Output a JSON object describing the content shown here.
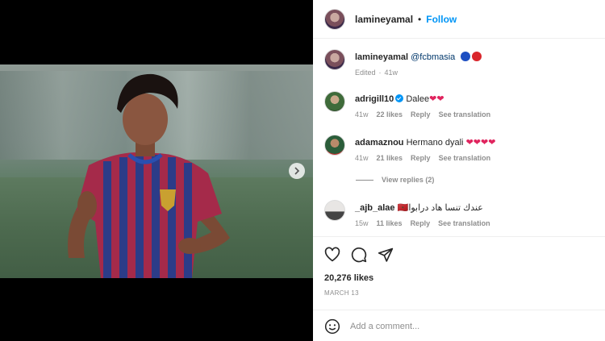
{
  "header": {
    "username": "lamineyamal",
    "separator": "•",
    "follow_label": "Follow"
  },
  "caption": {
    "username": "lamineyamal",
    "mention": "@fcbmasia",
    "status": "Edited",
    "time": "41w"
  },
  "comments": [
    {
      "username": "adrigill10",
      "text": "Dalee",
      "hearts": "❤❤",
      "time": "41w",
      "likes": "22 likes",
      "reply": "Reply",
      "translate": "See translation"
    },
    {
      "username": "adamaznou",
      "text": "Hermano dyali",
      "hearts": "❤❤❤❤",
      "time": "41w",
      "likes": "21 likes",
      "reply": "Reply",
      "translate": "See translation"
    },
    {
      "username": "_ajb_alae",
      "text": "عندك تنسا هاد درابوا🇲🇦",
      "time": "15w",
      "likes": "11 likes",
      "reply": "Reply",
      "translate": "See translation"
    }
  ],
  "view_replies": "View replies (2)",
  "likes_count": "20,276 likes",
  "post_date": "MARCH 13",
  "add_comment_placeholder": "Add a comment...",
  "carousel": {
    "slides": 2,
    "active": 0
  },
  "colors": {
    "accent": "#0095f6",
    "heart": "#e0245e"
  }
}
